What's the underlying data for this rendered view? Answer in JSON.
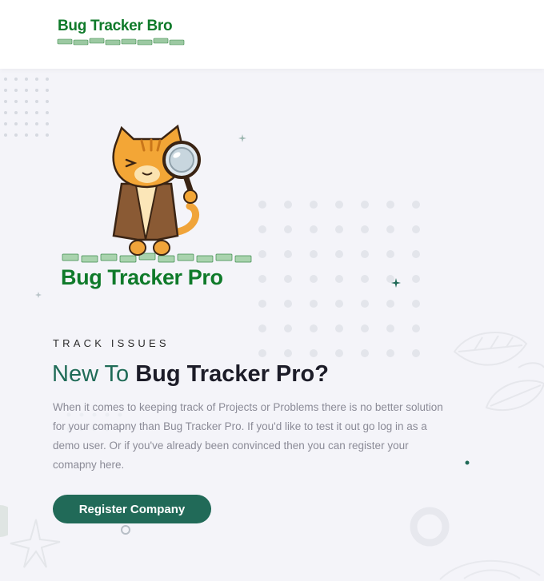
{
  "header": {
    "logo_text": "Bug Tracker Bro"
  },
  "hero": {
    "logo_text": "Bug Tracker Pro",
    "mascot_icon": "cat-detective-icon"
  },
  "content": {
    "eyebrow": "TRACK ISSUES",
    "headline_prefix": "New To ",
    "headline_strong": "Bug Tracker Pro?",
    "body": "When it comes to keeping track of Projects or Problems there is no better solution for your comapny than Bug Tracker Pro. If you'd like to test it out go log in as a demo user. Or if you've already been convinced then you can register your comapny here.",
    "cta_label": "Register Company"
  },
  "colors": {
    "brand_green": "#0f7a2a",
    "accent_teal": "#216a58",
    "background": "#f4f4f9"
  }
}
